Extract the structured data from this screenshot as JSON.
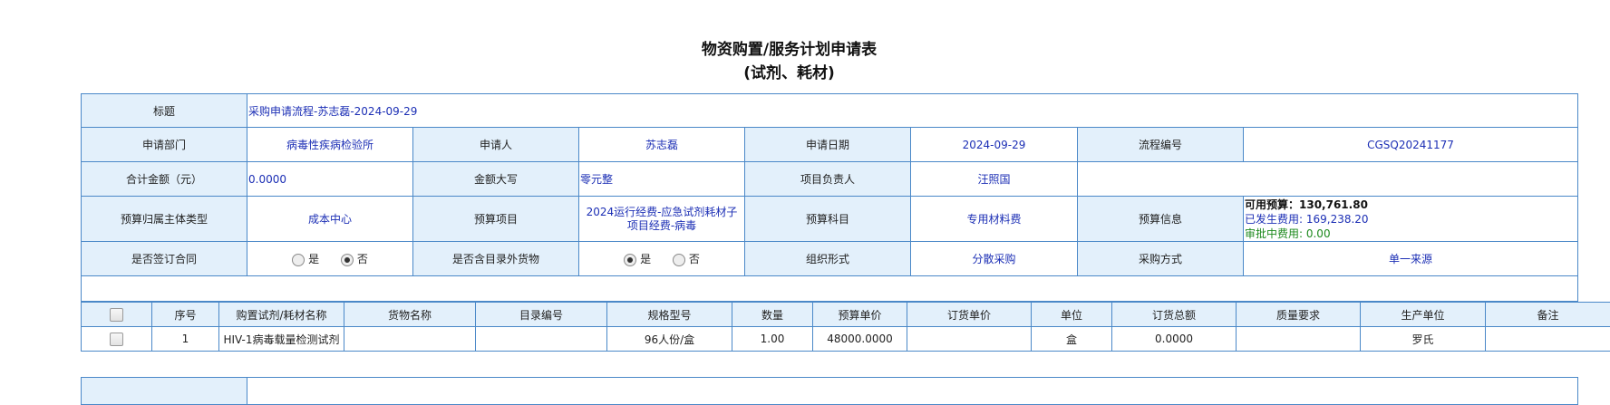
{
  "title": "物资购置/服务计划申请表",
  "subtitle": "(试剂、耗材)",
  "form": {
    "subject_label": "标题",
    "subject_value": "采购申请流程-苏志磊-2024-09-29",
    "dept_label": "申请部门",
    "dept_value": "病毒性疾病检验所",
    "applicant_label": "申请人",
    "applicant_value": "苏志磊",
    "date_label": "申请日期",
    "date_value": "2024-09-29",
    "flow_no_label": "流程编号",
    "flow_no_value": "CGSQ20241177",
    "total_label": "合计金额（元）",
    "total_value": "0.0000",
    "upper_label": "金额大写",
    "upper_value": "零元整",
    "pm_label": "项目负责人",
    "pm_value": "汪照国",
    "budget_type_label": "预算归属主体类型",
    "budget_type_value": "成本中心",
    "budget_item_label": "预算项目",
    "budget_item_value": "2024运行经费-应急试剂耗材子项目经费-病毒",
    "budget_subject_label": "预算科目",
    "budget_subject_value": "专用材料费",
    "budget_info_label": "预算信息",
    "budget_available": "可用预算：130,761.80",
    "budget_used": "已发生费用: 169,238.20",
    "budget_pending": "审批中费用: 0.00",
    "contract_label": "是否签订合同",
    "contract_yes": "是",
    "contract_no": "否",
    "contract_selected": "否",
    "catalog_label": "是否含目录外货物",
    "catalog_yes": "是",
    "catalog_no": "否",
    "catalog_selected": "是",
    "org_form_label": "组织形式",
    "org_form_value": "分散采购",
    "purchase_method_label": "采购方式",
    "purchase_method_value": "单一来源"
  },
  "items": {
    "headers": [
      "",
      "序号",
      "购置试剂/耗材名称",
      "货物名称",
      "目录编号",
      "规格型号",
      "数量",
      "预算单价",
      "订货单价",
      "单位",
      "订货总额",
      "质量要求",
      "生产单位",
      "备注"
    ],
    "rows": [
      [
        "",
        "1",
        "HIV-1病毒载量检测试剂",
        "",
        "",
        "96人份/盒",
        "1.00",
        "48000.0000",
        "",
        "盒",
        "0.0000",
        "",
        "罗氏",
        ""
      ]
    ]
  }
}
